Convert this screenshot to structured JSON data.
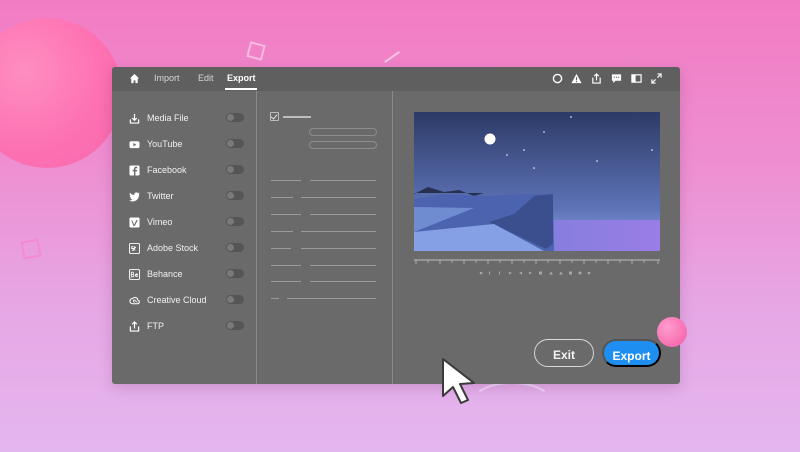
{
  "nav": {
    "tabs": [
      {
        "label": "Import"
      },
      {
        "label": "Edit"
      },
      {
        "label": "Export",
        "active": true
      }
    ],
    "toolbar_icons": [
      "circle-icon",
      "warning-icon",
      "share-icon",
      "comment-icon",
      "panel-icon",
      "expand-icon"
    ]
  },
  "destinations": [
    {
      "label": "Media File",
      "icon": "download-icon"
    },
    {
      "label": "YouTube",
      "icon": "youtube-icon"
    },
    {
      "label": "Facebook",
      "icon": "facebook-icon"
    },
    {
      "label": "Twitter",
      "icon": "twitter-icon"
    },
    {
      "label": "Vimeo",
      "icon": "vimeo-icon"
    },
    {
      "label": "Adobe Stock",
      "icon": "adobe-stock-icon"
    },
    {
      "label": "Behance",
      "icon": "behance-icon"
    },
    {
      "label": "Creative Cloud",
      "icon": "creative-cloud-icon"
    },
    {
      "label": "FTP",
      "icon": "upload-icon"
    }
  ],
  "actions": {
    "exit_label": "Exit",
    "export_label": "Export"
  },
  "colors": {
    "accent": "#1f8ef1",
    "window": "#6a6a6a",
    "background_top": "#f27cc4",
    "background_bottom": "#e4b6ef"
  }
}
